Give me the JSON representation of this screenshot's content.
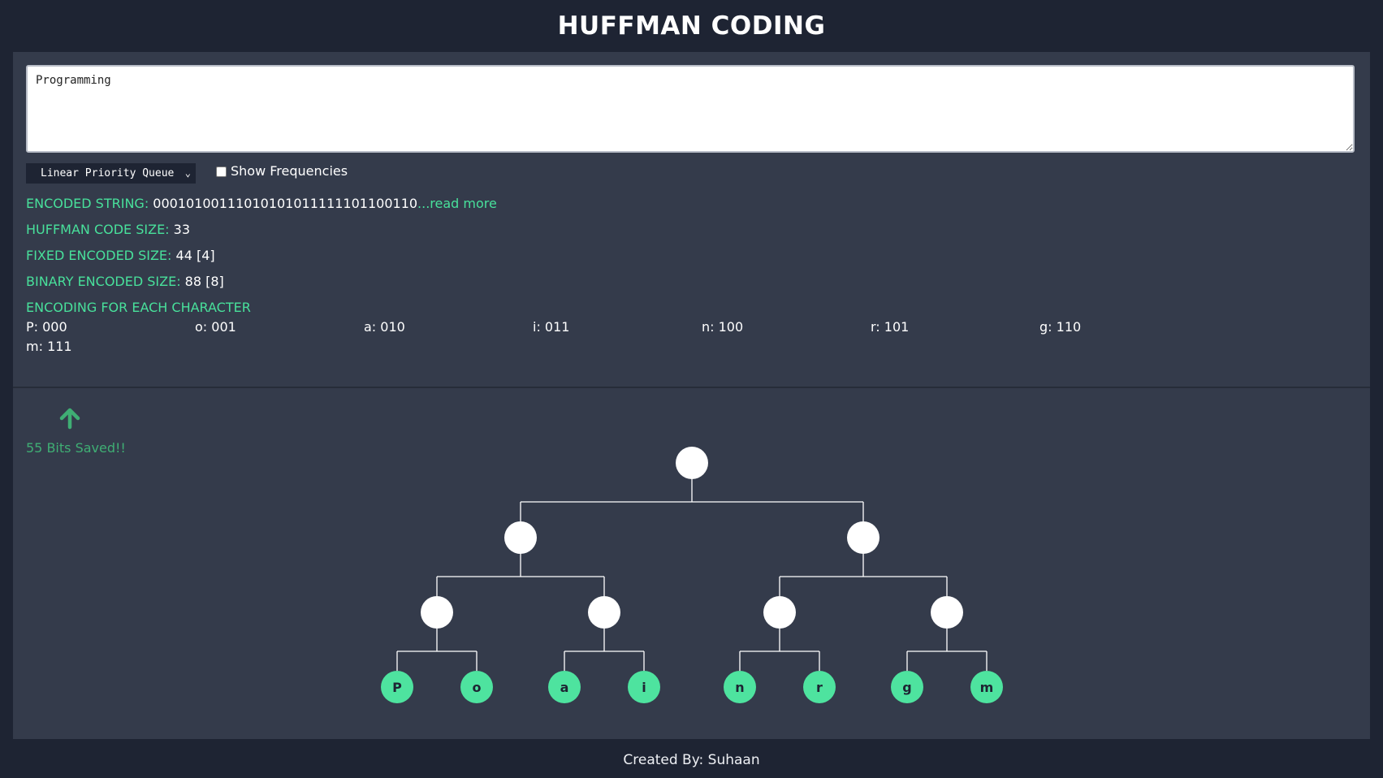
{
  "title": "HUFFMAN CODING",
  "input": {
    "value": "Programming"
  },
  "queue_select": {
    "selected": "Linear Priority Queue"
  },
  "show_frequencies": {
    "label": "Show Frequencies",
    "checked": false
  },
  "results": {
    "encoded_label": "ENCODED STRING:",
    "encoded_value": "00010100111010101011111101100110",
    "read_more": "...read more",
    "huffman_label": "HUFFMAN CODE SIZE:",
    "huffman_value": "33",
    "fixed_label": "FIXED ENCODED SIZE:",
    "fixed_value": "44 [4]",
    "binary_label": "BINARY ENCODED SIZE:",
    "binary_value": "88 [8]",
    "each_label": "ENCODING FOR EACH CHARACTER"
  },
  "encodings": [
    "P: 000",
    "o: 001",
    "a: 010",
    "i: 011",
    "n: 100",
    "r: 101",
    "g: 110",
    "m: 111"
  ],
  "savings": {
    "text": "55 Bits Saved!!",
    "icon": "arrow-up-icon"
  },
  "tree": {
    "leaves": [
      "P",
      "o",
      "a",
      "i",
      "n",
      "r",
      "g",
      "m"
    ]
  },
  "colors": {
    "accent": "#48e09b",
    "node": "#ffffff",
    "leaf": "#4ee39f",
    "saved": "#3fae74"
  },
  "footer": "Created By: Suhaan"
}
